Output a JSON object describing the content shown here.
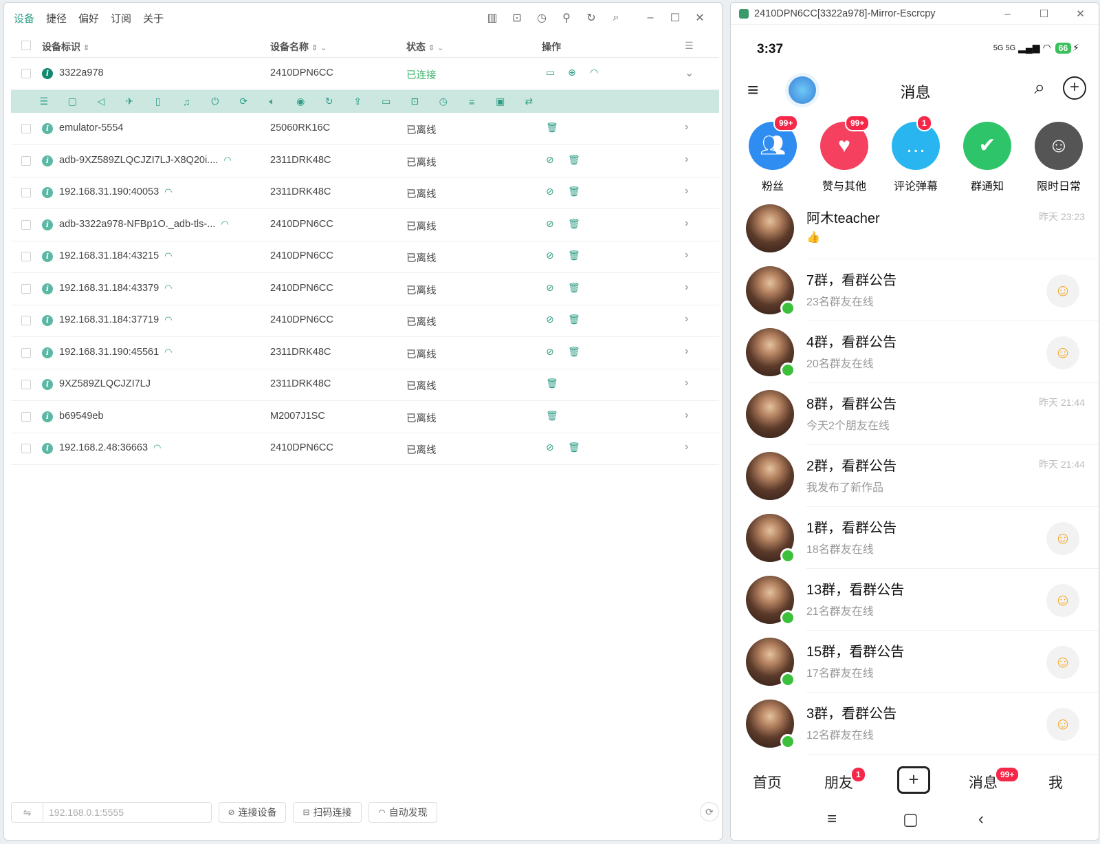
{
  "left": {
    "tabs": [
      "设备",
      "捷径",
      "偏好",
      "订阅",
      "关于"
    ],
    "columns": {
      "id": "设备标识",
      "name": "设备名称",
      "status": "状态",
      "ops": "操作"
    },
    "devices": [
      {
        "id": "3322a978",
        "name": "2410DPN6CC",
        "status": "已连接",
        "wifi": false
      },
      {
        "id": "emulator-5554",
        "name": "25060RK16C",
        "status": "已离线",
        "wifi": false
      },
      {
        "id": "adb-9XZ589ZLQCJZI7LJ-X8Q20i....",
        "name": "2311DRK48C",
        "status": "已离线",
        "wifi": true
      },
      {
        "id": "192.168.31.190:40053",
        "name": "2311DRK48C",
        "status": "已离线",
        "wifi": true
      },
      {
        "id": "adb-3322a978-NFBp1O._adb-tls-...",
        "name": "2410DPN6CC",
        "status": "已离线",
        "wifi": true
      },
      {
        "id": "192.168.31.184:43215",
        "name": "2410DPN6CC",
        "status": "已离线",
        "wifi": true
      },
      {
        "id": "192.168.31.184:43379",
        "name": "2410DPN6CC",
        "status": "已离线",
        "wifi": true
      },
      {
        "id": "192.168.31.184:37719",
        "name": "2410DPN6CC",
        "status": "已离线",
        "wifi": true
      },
      {
        "id": "192.168.31.190:45561",
        "name": "2311DRK48C",
        "status": "已离线",
        "wifi": true
      },
      {
        "id": "9XZ589ZLQCJZI7LJ",
        "name": "2311DRK48C",
        "status": "已离线",
        "wifi": false
      },
      {
        "id": "b69549eb",
        "name": "M2007J1SC",
        "status": "已离线",
        "wifi": false
      },
      {
        "id": "192.168.2.48:36663",
        "name": "2410DPN6CC",
        "status": "已离线",
        "wifi": true
      }
    ],
    "bottom": {
      "address_placeholder": "192.168.0.1:5555",
      "connect": "连接设备",
      "scan": "扫码连接",
      "discover": "自动发现"
    }
  },
  "right": {
    "window_title": "2410DPN6CC[3322a978]-Mirror-Escrcpy",
    "time": "3:37",
    "signal": "5G 5G",
    "battery": "66",
    "header_title": "消息",
    "categories": [
      {
        "label": "粉丝",
        "badge": "99+",
        "color": "#2f8cf0"
      },
      {
        "label": "赞与其他",
        "badge": "99+",
        "color": "#f5405f"
      },
      {
        "label": "评论弹幕",
        "badge": "1",
        "color": "#29b6f0"
      },
      {
        "label": "群通知",
        "badge": "",
        "color": "#2ec46a"
      },
      {
        "label": "限时日常",
        "badge": "",
        "color": "#555555"
      }
    ],
    "messages": [
      {
        "title": "阿木teacher",
        "sub": "👍",
        "time": "昨天 23:23",
        "online": false,
        "emoji": false
      },
      {
        "title": "7群，看群公告",
        "sub": "23名群友在线",
        "time": "",
        "online": true,
        "emoji": true
      },
      {
        "title": "4群，看群公告",
        "sub": "20名群友在线",
        "time": "",
        "online": true,
        "emoji": true
      },
      {
        "title": "8群，看群公告",
        "sub": "今天2个朋友在线",
        "time": "昨天 21:44",
        "online": false,
        "emoji": false
      },
      {
        "title": "2群，看群公告",
        "sub": "我发布了新作品",
        "time": "昨天 21:44",
        "online": false,
        "emoji": false
      },
      {
        "title": "1群，看群公告",
        "sub": "18名群友在线",
        "time": "",
        "online": true,
        "emoji": true
      },
      {
        "title": "13群，看群公告",
        "sub": "21名群友在线",
        "time": "",
        "online": true,
        "emoji": true
      },
      {
        "title": "15群，看群公告",
        "sub": "17名群友在线",
        "time": "",
        "online": true,
        "emoji": true
      },
      {
        "title": "3群，看群公告",
        "sub": "12名群友在线",
        "time": "",
        "online": true,
        "emoji": true
      }
    ],
    "nav": {
      "home": "首页",
      "friends": "朋友",
      "friends_badge": "1",
      "messages": "消息",
      "messages_badge": "99+",
      "me": "我"
    }
  }
}
